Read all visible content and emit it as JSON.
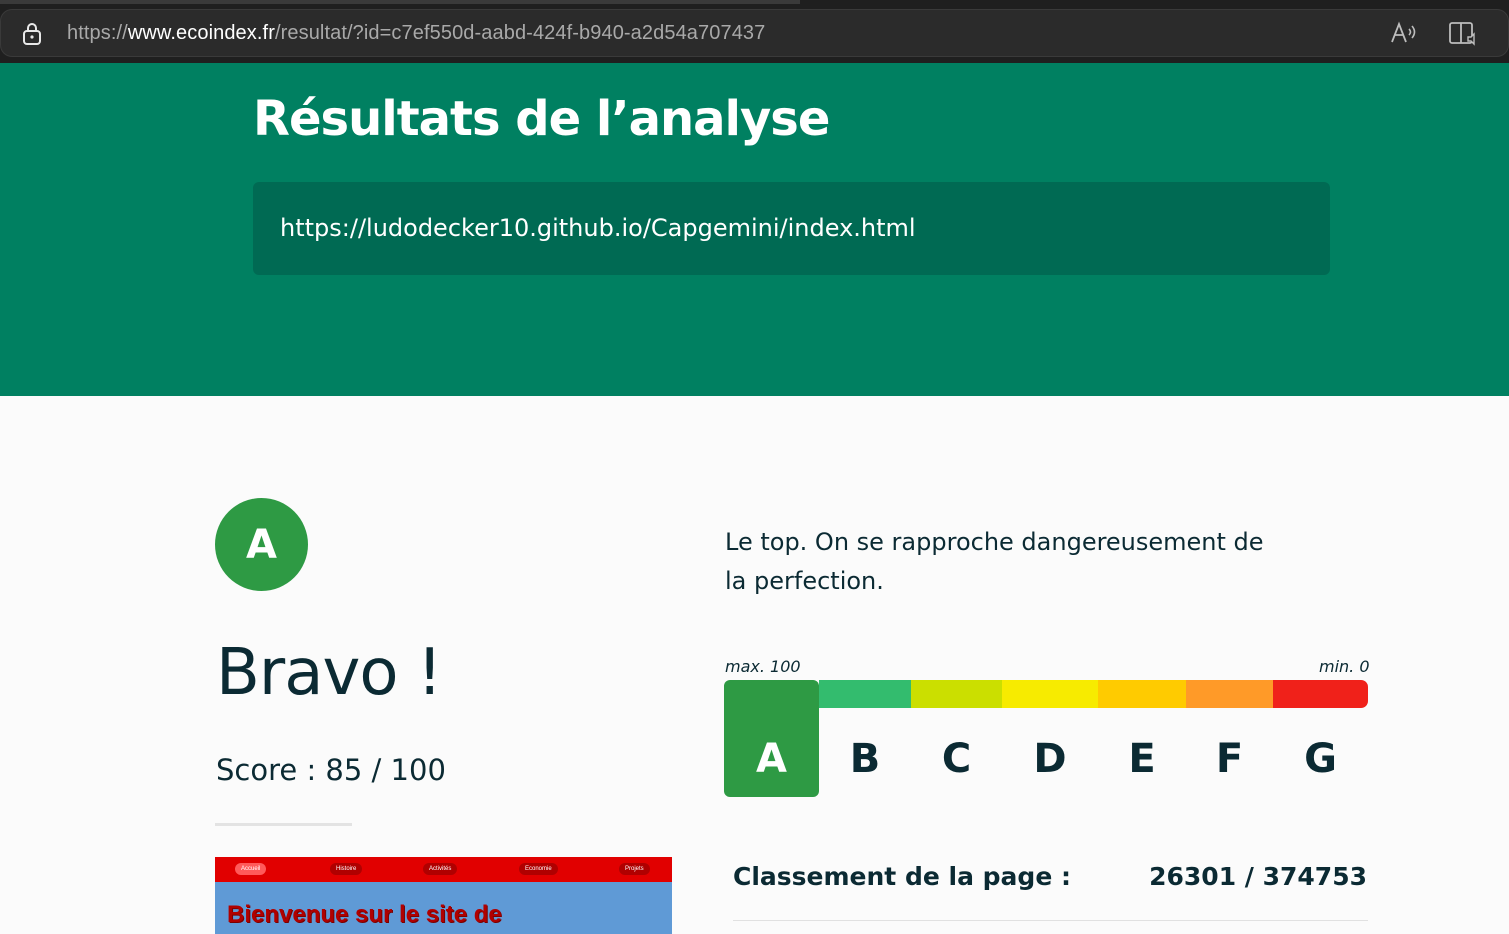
{
  "browser": {
    "url_scheme": "https://",
    "url_host": "www.ecoindex.fr",
    "url_path": "/resultat/?id=c7ef550d-aabd-424f-b940-a2d54a707437",
    "icons": [
      "lock-icon",
      "read-aloud-icon",
      "immersive-reader-icon"
    ]
  },
  "hero": {
    "title": "Résultats de l’analyse",
    "analyzed_url": "https://ludodecker10.github.io/Capgemini/index.html",
    "color": "#008061"
  },
  "result": {
    "grade": "A",
    "headline": "Bravo !",
    "score_text": "Score : 85 / 100",
    "verdict": "Le top. On se rapproche dangereusement de la perfection."
  },
  "scale": {
    "max_label": "max. 100",
    "min_label": "min. 0",
    "active_grade": "A",
    "grades": [
      {
        "letter": "A",
        "color": "#2e9a44"
      },
      {
        "letter": "B",
        "color": "#33bc6e"
      },
      {
        "letter": "C",
        "color": "#cbdf00"
      },
      {
        "letter": "D",
        "color": "#f7eb00"
      },
      {
        "letter": "E",
        "color": "#ffcb00"
      },
      {
        "letter": "F",
        "color": "#ff9a28"
      },
      {
        "letter": "G",
        "color": "#f0211a"
      }
    ]
  },
  "ranking": {
    "label": "Classement de la page :",
    "value": "26301 / 374753"
  },
  "thumbnail": {
    "nav_items": [
      "Accueil",
      "Histoire",
      "Activités",
      "Economie",
      "Projets"
    ],
    "headline": "Bienvenue sur le site de"
  }
}
